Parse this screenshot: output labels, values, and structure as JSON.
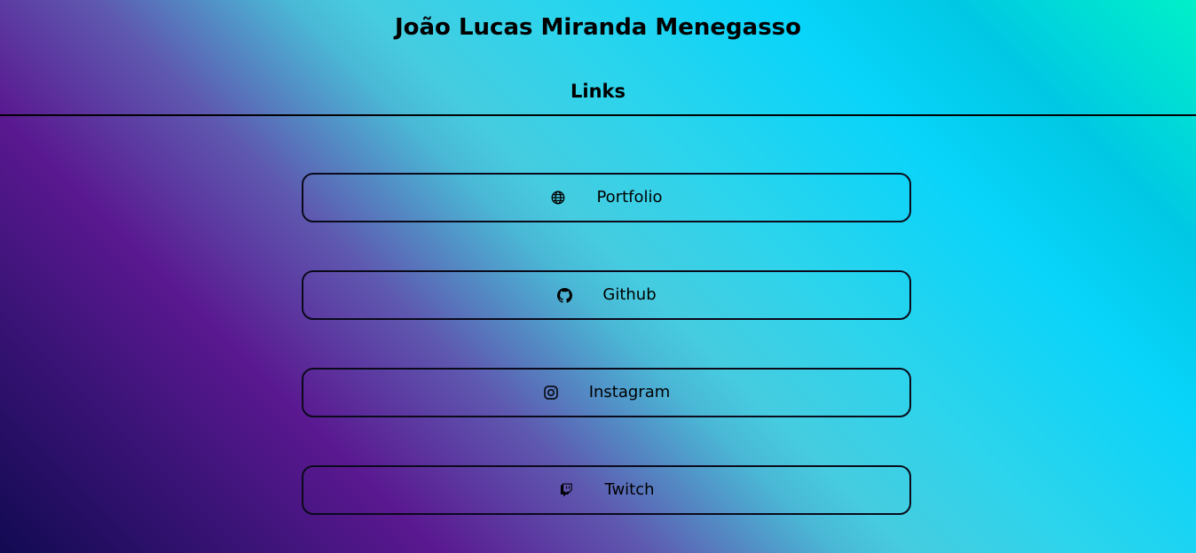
{
  "header": {
    "name": "João Lucas Miranda Menegasso",
    "section": "Links"
  },
  "links": [
    {
      "label": "Portfolio",
      "icon": "globe-icon"
    },
    {
      "label": "Github",
      "icon": "github-icon"
    },
    {
      "label": "Instagram",
      "icon": "instagram-icon"
    },
    {
      "label": "Twitch",
      "icon": "twitch-icon"
    }
  ],
  "colors": {
    "border": "#0a0a1a",
    "gradient_start": "#120a52",
    "gradient_mid_purple": "#5a1890",
    "gradient_mid_cyan": "#08d4fa",
    "gradient_end": "#00f0c8"
  }
}
